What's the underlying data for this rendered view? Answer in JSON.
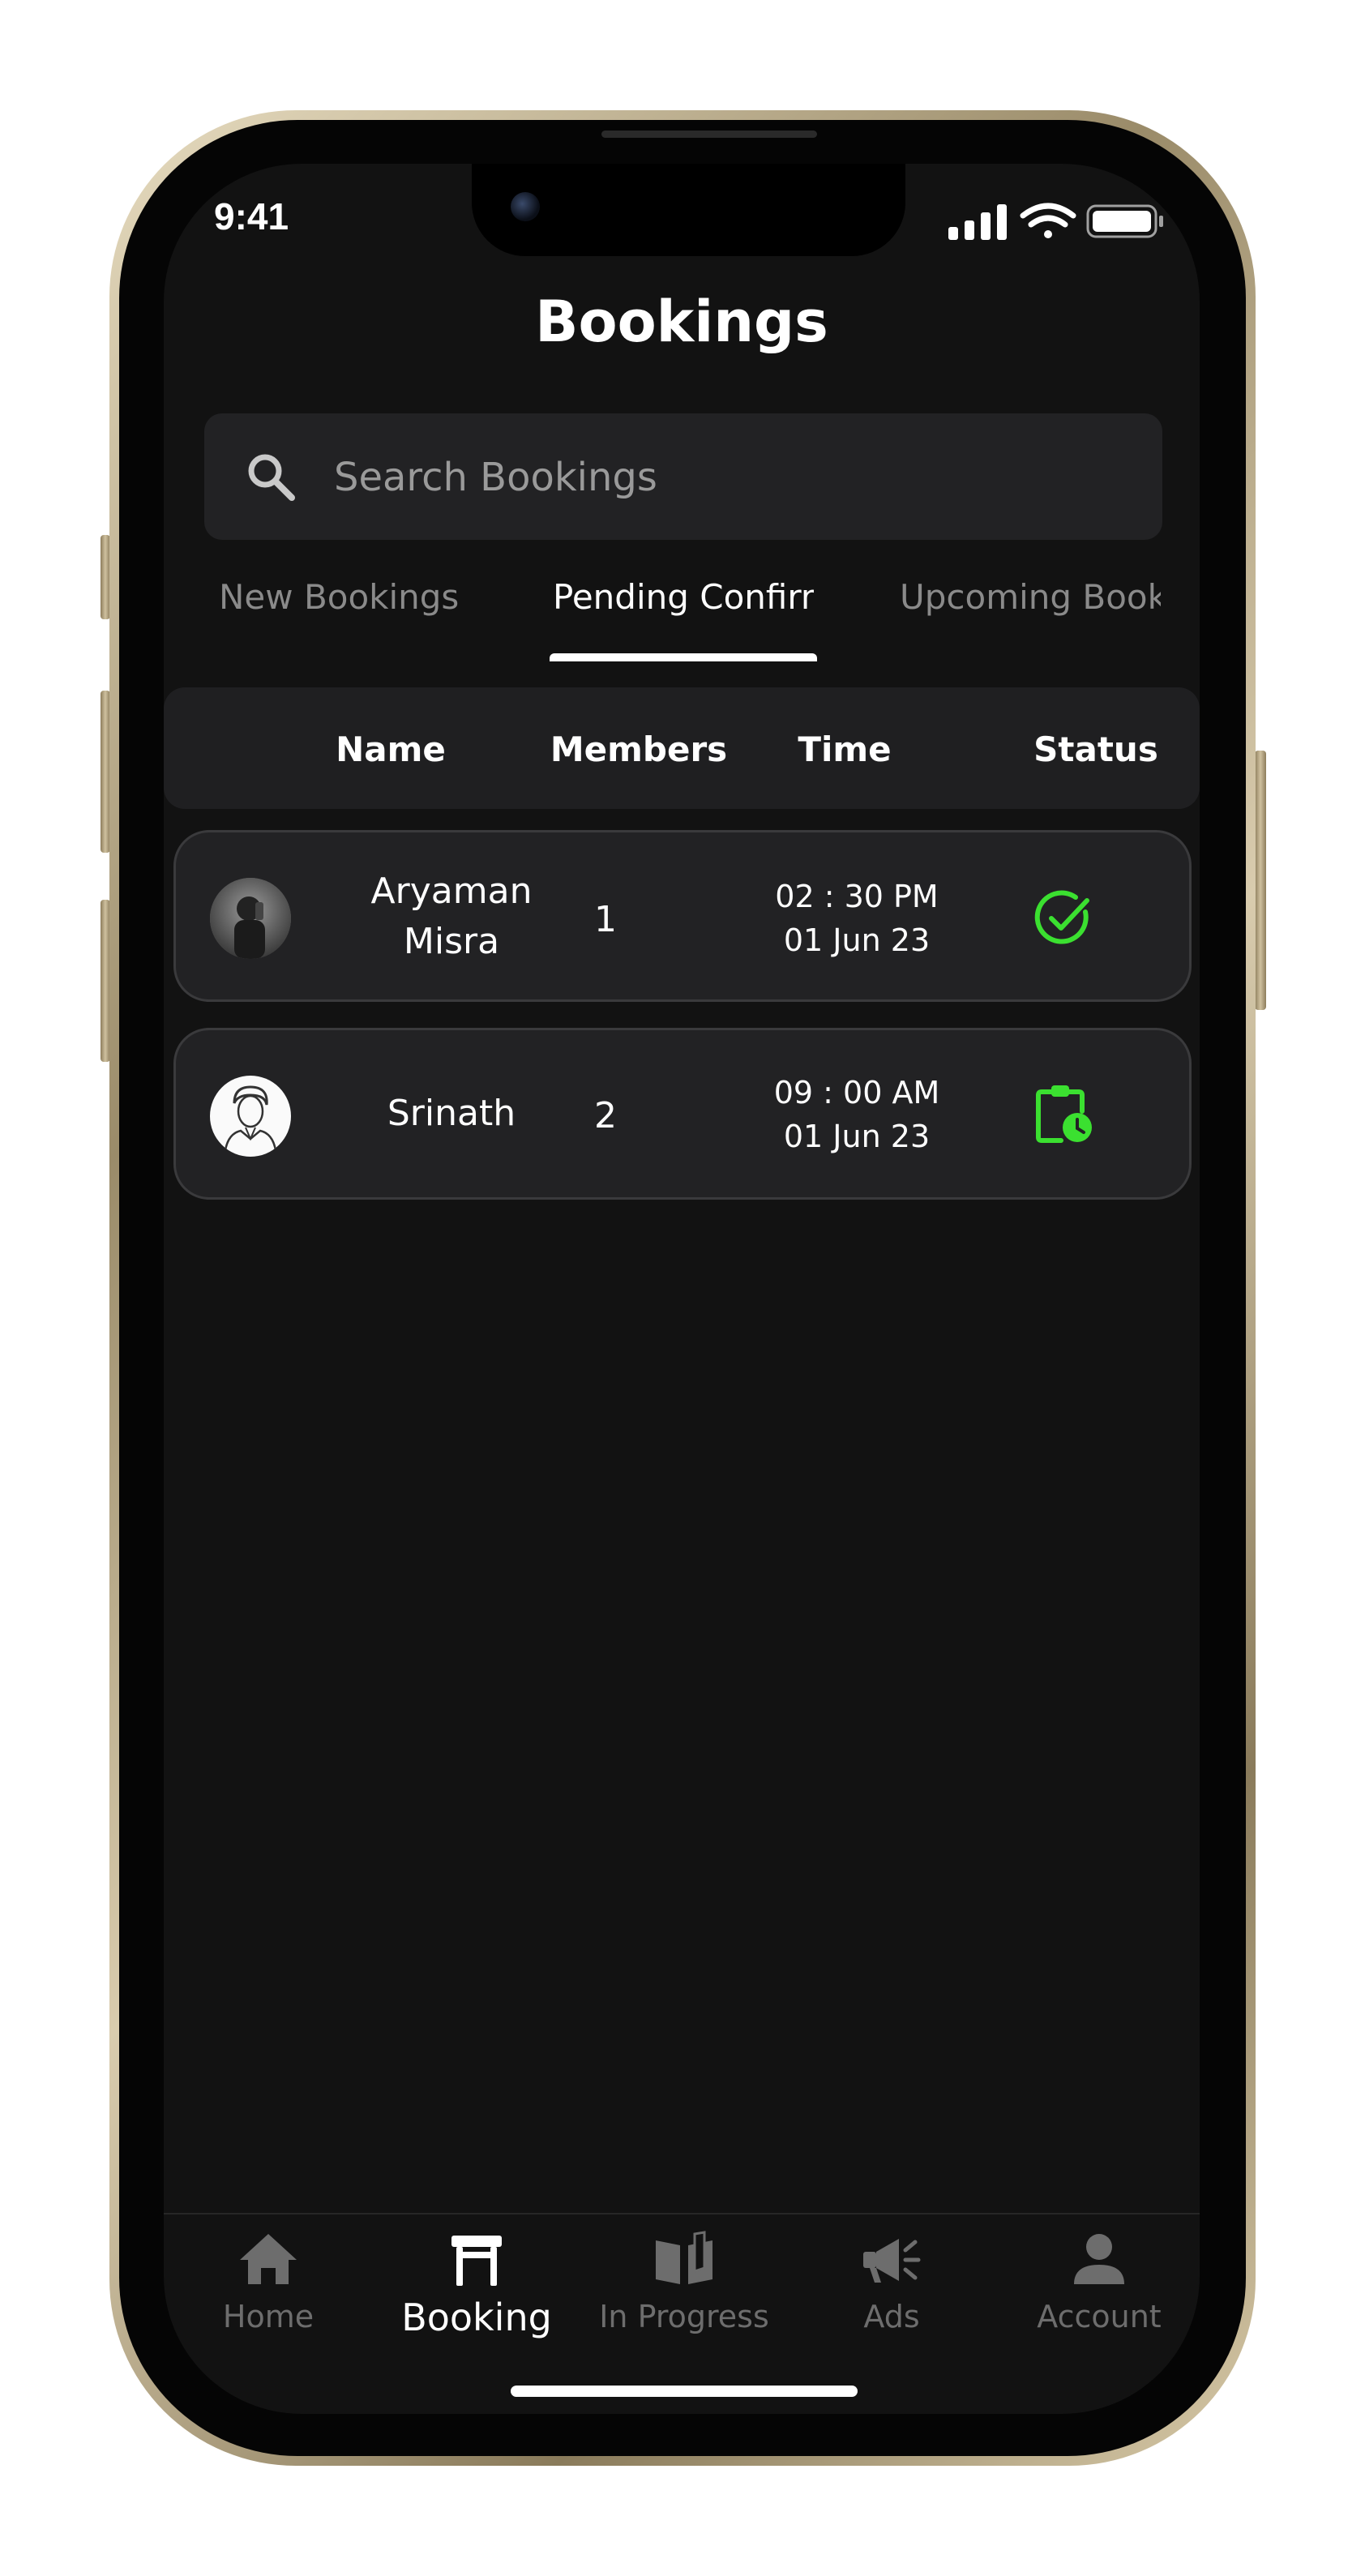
{
  "status_bar": {
    "time": "9:41"
  },
  "header": {
    "title": "Bookings"
  },
  "search": {
    "placeholder": "Search Bookings"
  },
  "tabs": [
    {
      "label": "New Bookings",
      "active": false
    },
    {
      "label": "Pending Confirmation",
      "active": true
    },
    {
      "label": "Upcoming Bookings",
      "active": false
    }
  ],
  "table": {
    "columns": [
      "Name",
      "Members",
      "Time",
      "Status"
    ],
    "rows": [
      {
        "name_line1": "Aryaman",
        "name_line2": "Misra",
        "members": "1",
        "time": "02 : 30  PM",
        "date": "01 Jun 23",
        "status_icon": "check-circle-icon"
      },
      {
        "name_line1": "Srinath",
        "name_line2": "",
        "members": "2",
        "time": "09 : 00  AM",
        "date": "01 Jun 23",
        "status_icon": "clipboard-clock-icon"
      }
    ]
  },
  "bottom_nav": [
    {
      "label": "Home",
      "icon": "home-icon",
      "active": false
    },
    {
      "label": "Booking",
      "icon": "table-icon",
      "active": true
    },
    {
      "label": "In Progress",
      "icon": "open-book-icon",
      "active": false
    },
    {
      "label": "Ads",
      "icon": "megaphone-icon",
      "active": false
    },
    {
      "label": "Account",
      "icon": "person-icon",
      "active": false
    }
  ],
  "colors": {
    "background": "#121212",
    "surface": "#222224",
    "accent_green": "#3be030",
    "text_primary": "#ffffff",
    "text_muted": "#8a8a8a"
  }
}
